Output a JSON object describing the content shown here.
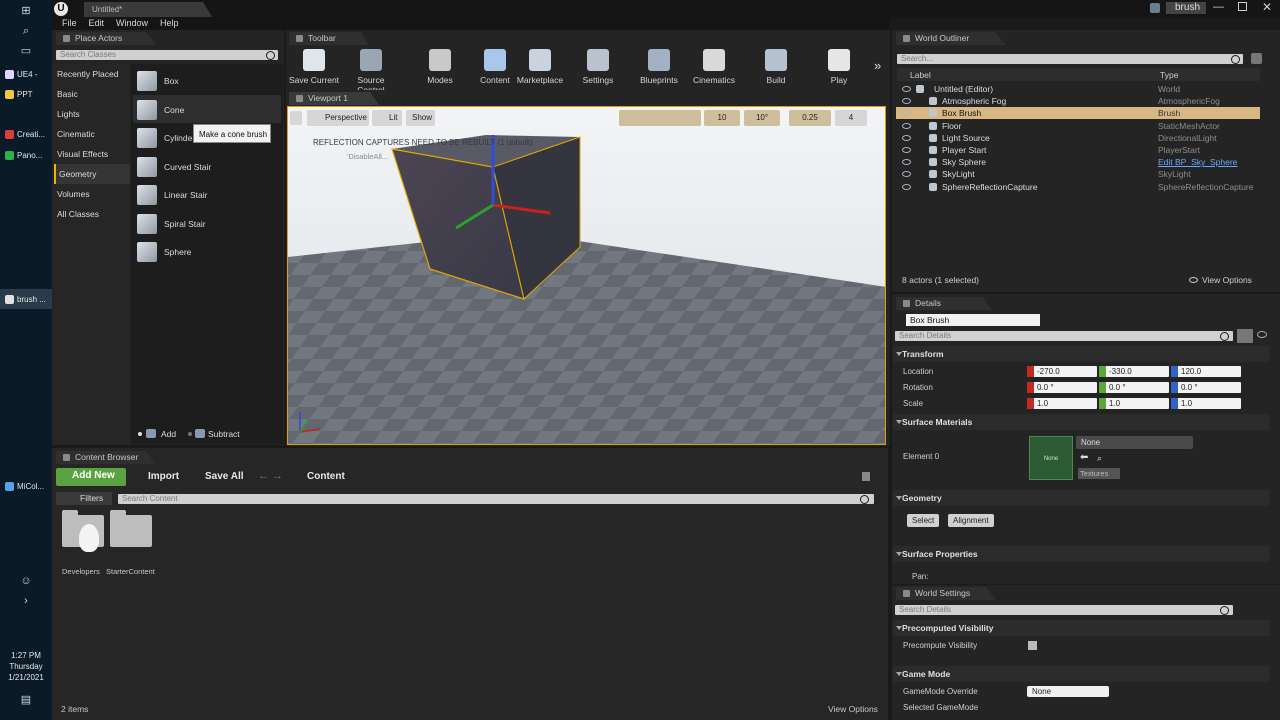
{
  "taskbar": {
    "items": [
      {
        "label": "UE4 -",
        "color": "#e7d3ff"
      },
      {
        "label": "PPT",
        "color": "#f4c542"
      },
      {
        "label": "Creati...",
        "color": "#e03b3b"
      },
      {
        "label": "Pano...",
        "color": "#2ab24a"
      },
      {
        "label": "brush ...",
        "color": "#e0e0e0"
      },
      {
        "label": "MiCol...",
        "color": "#5aa0e6"
      }
    ],
    "clock_time": "1:27 PM",
    "clock_day": "Thursday",
    "clock_date": "1/21/2021"
  },
  "window": {
    "doc_tab": "Untitled*",
    "project_name": "brush"
  },
  "menu": [
    "File",
    "Edit",
    "Window",
    "Help"
  ],
  "place_actors": {
    "tab": "Place Actors",
    "search_placeholder": "Search Classes",
    "categories": [
      "Recently Placed",
      "Basic",
      "Lights",
      "Cinematic",
      "Visual Effects",
      "Geometry",
      "Volumes",
      "All Classes"
    ],
    "selected_category": "Geometry",
    "items": [
      "Box",
      "Cone",
      "Cylinder",
      "Curved Stair",
      "Linear Stair",
      "Spiral Stair",
      "Sphere"
    ],
    "tooltip": "Make a cone brush",
    "add_label": "Add",
    "subtract_label": "Subtract"
  },
  "toolbar": {
    "tab": "Toolbar",
    "buttons": [
      {
        "label": "Save Current",
        "color": "#dfe6ee"
      },
      {
        "label": "Source Control",
        "color": "#9aa6b4"
      },
      {
        "label": "Modes",
        "color": "#c9c9c9"
      },
      {
        "label": "Content",
        "color": "#a9c7ea"
      },
      {
        "label": "Marketplace",
        "color": "#c9d3df"
      },
      {
        "label": "Settings",
        "color": "#b9c2cd"
      },
      {
        "label": "Blueprints",
        "color": "#a3b1c4"
      },
      {
        "label": "Cinematics",
        "color": "#d9d9d9"
      },
      {
        "label": "Build",
        "color": "#b6c2d1"
      },
      {
        "label": "Play",
        "color": "#e6e6e6"
      }
    ]
  },
  "viewport": {
    "tab": "Viewport 1",
    "perspective": "Perspective",
    "lit": "Lit",
    "show": "Show",
    "grid_snap": "10",
    "rot_snap": "10°",
    "scale_snap": "0.25",
    "cam_speed": "4",
    "warning": "REFLECTION CAPTURES NEED TO BE REBUILT (1 unbuilt)",
    "warning_sub": "'DisableAll..."
  },
  "outliner": {
    "tab": "World Outliner",
    "search_placeholder": "Search...",
    "col_label": "Label",
    "col_type": "Type",
    "rows": [
      {
        "label": "Untitled (Editor)",
        "type": "World",
        "indent": 0
      },
      {
        "label": "Atmospheric Fog",
        "type": "AtmosphericFog",
        "indent": 1
      },
      {
        "label": "Box Brush",
        "type": "Brush",
        "indent": 1
      },
      {
        "label": "Floor",
        "type": "StaticMeshActor",
        "indent": 1
      },
      {
        "label": "Light Source",
        "type": "DirectionalLight",
        "indent": 1
      },
      {
        "label": "Player Start",
        "type": "PlayerStart",
        "indent": 1
      },
      {
        "label": "Sky Sphere",
        "type": "Edit BP_Sky_Sphere",
        "indent": 1
      },
      {
        "label": "SkyLight",
        "type": "SkyLight",
        "indent": 1
      },
      {
        "label": "SphereReflectionCapture",
        "type": "SphereReflectionCapture",
        "indent": 1
      }
    ],
    "selected_row": "Box Brush",
    "count": "8 actors (1 selected)",
    "view_options": "View Options"
  },
  "details": {
    "tab": "Details",
    "name": "Box Brush",
    "search_placeholder": "Search Details",
    "transform": "Transform",
    "location_label": "Location",
    "rotation_label": "Rotation",
    "scale_label": "Scale",
    "location": [
      "-270.0",
      "-330.0",
      "120.0"
    ],
    "rotation": [
      "0.0 °",
      "0.0 °",
      "0.0 °"
    ],
    "scale": [
      "1.0",
      "1.0",
      "1.0"
    ],
    "surface_materials": "Surface Materials",
    "element0": "Element 0",
    "material_none": "None",
    "material_value": "None",
    "textures": "Textures",
    "geometry": "Geometry",
    "select_btn": "Select",
    "alignment_btn": "Alignment",
    "surface_properties": "Surface Properties",
    "pan": "Pan:"
  },
  "world_settings": {
    "tab": "World Settings",
    "search_placeholder": "Search Details",
    "precomputed": "Precomputed Visibility",
    "precompute_label": "Precompute Visibility",
    "game_mode": "Game Mode",
    "gamemode_override": "GameMode Override",
    "gamemode_value": "None",
    "selected_gamemode": "Selected GameMode"
  },
  "content_browser": {
    "tab": "Content Browser",
    "add_new": "Add New",
    "import": "Import",
    "save_all": "Save All",
    "path": "Content",
    "filters": "Filters",
    "search_placeholder": "Search Content",
    "folders": [
      "Developers",
      "StarterContent"
    ],
    "count": "2 items",
    "view_options": "View Options"
  }
}
